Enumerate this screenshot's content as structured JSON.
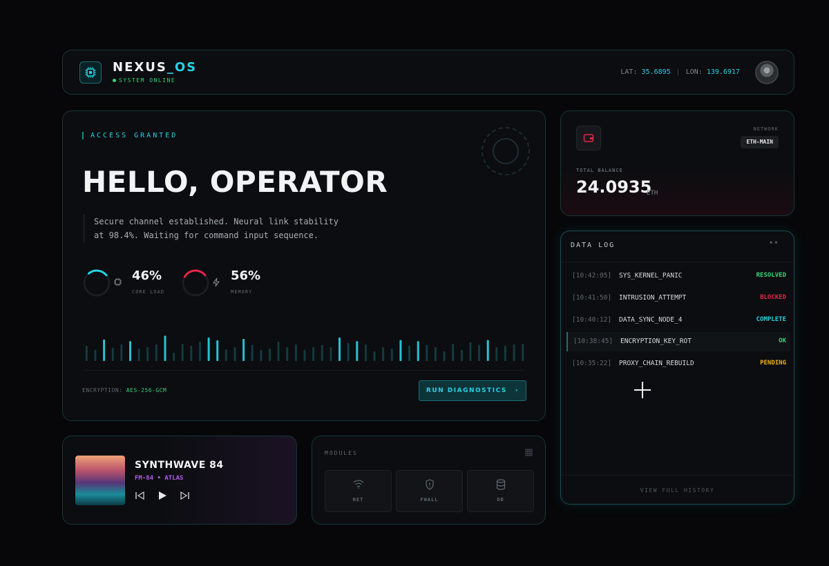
{
  "header": {
    "brand_prefix": "NEXUS",
    "brand_suffix": "_OS",
    "status": "SYSTEM ONLINE",
    "lat_label": "LAT:",
    "lat_value": "35.6895",
    "lon_label": "LON:",
    "lon_value": "139.6917",
    "icons": {
      "logo": "chip-icon",
      "avatar": "user-avatar"
    }
  },
  "hero": {
    "access_label": "ACCESS GRANTED",
    "title": "HELLO, OPERATOR",
    "description": "Secure channel established. Neural link stability at 98.4%. Waiting for command input sequence.",
    "gauges": [
      {
        "value": "46%",
        "fraction": 0.46,
        "label": "CORE LOAD",
        "color": "#27d3e3",
        "icon": "cpu-icon"
      },
      {
        "value": "56%",
        "fraction": 0.56,
        "label": "MEMORY",
        "color": "#e8254a",
        "icon": "bolt-icon"
      }
    ],
    "activity_levels": [
      0.55,
      0.4,
      0.78,
      0.48,
      0.6,
      0.72,
      0.45,
      0.5,
      0.6,
      0.92,
      0.3,
      0.62,
      0.55,
      0.7,
      0.85,
      0.75,
      0.42,
      0.5,
      0.8,
      0.58,
      0.4,
      0.45,
      0.7,
      0.5,
      0.6,
      0.4,
      0.5,
      0.58,
      0.5,
      0.85,
      0.65,
      0.72,
      0.6,
      0.35,
      0.5,
      0.45,
      0.76,
      0.55,
      0.72,
      0.58,
      0.5,
      0.35,
      0.62,
      0.4,
      0.68,
      0.58,
      0.76,
      0.5,
      0.55,
      0.6,
      0.62
    ],
    "encryption_label": "ENCRYPTION:",
    "encryption_value": "AES-256-GCM",
    "run_button": "RUN DIAGNOSTICS",
    "run_chevron": "›"
  },
  "music": {
    "track": "SYNTHWAVE 84",
    "station": "FM-84 • ATLAS",
    "icons": [
      "skip-back-icon",
      "play-icon",
      "skip-forward-icon"
    ]
  },
  "modules": {
    "title": "MODULES",
    "items": [
      {
        "label": "NET",
        "icon": "wifi-icon"
      },
      {
        "label": "FWALL",
        "icon": "shield-icon"
      },
      {
        "label": "DB",
        "icon": "database-icon"
      }
    ]
  },
  "wallet": {
    "network_label": "NETWORK",
    "network_value": "ETH-MAIN",
    "balance_label": "TOTAL BALANCE",
    "balance": "24.0935",
    "unit": "ETH"
  },
  "datalog": {
    "title": "DATA LOG",
    "menu": "••",
    "rows": [
      {
        "time": "[10:42:05]",
        "event": "SYS_KERNEL_PANIC",
        "status": "RESOLVED",
        "color": "#38d27a"
      },
      {
        "time": "[10:41:50]",
        "event": "INTRUSION_ATTEMPT",
        "status": "BLOCKED",
        "color": "#e8254a"
      },
      {
        "time": "[10:40:12]",
        "event": "DATA_SYNC_NODE_4",
        "status": "COMPLETE",
        "color": "#27d3e3"
      },
      {
        "time": "[10:38:45]",
        "event": "ENCRYPTION_KEY_ROT",
        "status": "OK",
        "color": "#38d27a"
      },
      {
        "time": "[10:35:22]",
        "event": "PROXY_CHAIN_REBUILD",
        "status": "PENDING",
        "color": "#f2b11d"
      }
    ],
    "view_all": "VIEW FULL HISTORY"
  }
}
